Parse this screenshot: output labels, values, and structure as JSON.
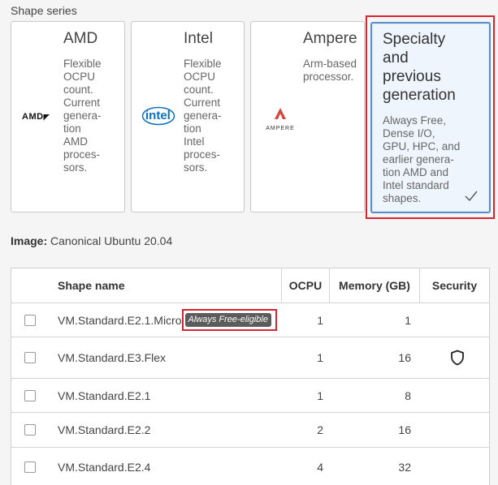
{
  "shape_series": {
    "label": "Shape series",
    "cards": [
      {
        "title": "AMD",
        "description": "Flexible OCPU count. Current generation AMD processors.",
        "desc_lines": [
          "Flexible",
          "OCPU",
          "count.",
          "Current",
          "genera-",
          "tion",
          "AMD",
          "proces-",
          "sors."
        ],
        "logo": "AMD"
      },
      {
        "title": "Intel",
        "description": "Flexible OCPU count. Current generation Intel processors.",
        "desc_lines": [
          "Flexible",
          "OCPU",
          "count.",
          "Current",
          "genera-",
          "tion",
          "Intel",
          "proces-",
          "sors."
        ],
        "logo": "intel"
      },
      {
        "title": "Ampere",
        "description": "Arm-based processor.",
        "desc_lines": [
          "Arm-based",
          "processor."
        ],
        "logo": "AMPERE"
      },
      {
        "title": "Specialty and previous generation",
        "title_lines": [
          "Specialty",
          "and",
          "previous",
          "generation"
        ],
        "description": "Always Free, Dense I/O, GPU, HPC, and earlier generation AMD and Intel standard shapes.",
        "desc_lines": [
          "Always Free,",
          "Dense I/O,",
          "GPU, HPC, and",
          "earlier genera-",
          "tion AMD and",
          "Intel standard",
          "shapes."
        ],
        "selected": true,
        "check_icon": "checkmark-icon"
      }
    ]
  },
  "image": {
    "label": "Image:",
    "value": "Canonical Ubuntu 20.04"
  },
  "table": {
    "columns": [
      "Shape name",
      "OCPU",
      "Memory (GB)",
      "Security"
    ],
    "rows": [
      {
        "name": "VM.Standard.E2.1.Micro",
        "badge": "Always Free-eligible",
        "ocpu": "1",
        "memory": "1",
        "security": ""
      },
      {
        "name": "VM.Standard.E3.Flex",
        "badge": "",
        "ocpu": "1",
        "memory": "16",
        "security": "shield-icon"
      },
      {
        "name": "VM.Standard.E2.1",
        "badge": "",
        "ocpu": "1",
        "memory": "8",
        "security": ""
      },
      {
        "name": "VM.Standard.E2.2",
        "badge": "",
        "ocpu": "2",
        "memory": "16",
        "security": ""
      },
      {
        "name": "VM.Standard.E2.4",
        "badge": "",
        "ocpu": "4",
        "memory": "32",
        "security": ""
      }
    ]
  },
  "colors": {
    "highlight": "#d9232e",
    "selected_border": "#5a8fc9",
    "selected_bg": "#eef5fd",
    "badge_bg": "#5b5b5b"
  }
}
